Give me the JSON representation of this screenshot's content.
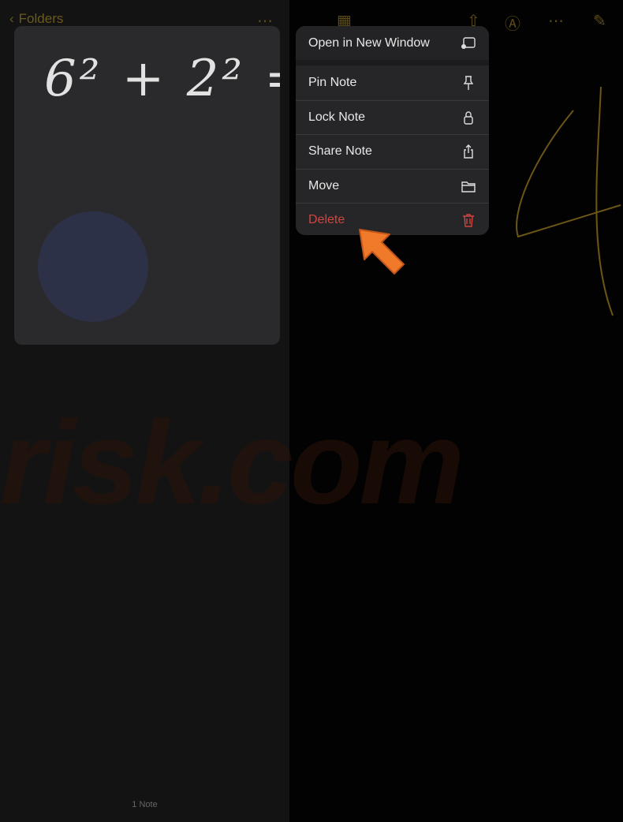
{
  "nav": {
    "back_label": "Folders"
  },
  "note_preview": {
    "handwriting": "6² + 2² = 4"
  },
  "context_menu": {
    "items": [
      {
        "label": "Open in New Window",
        "icon": "new-window-icon"
      },
      {
        "label": "Pin Note",
        "icon": "pin-icon"
      },
      {
        "label": "Lock Note",
        "icon": "lock-icon"
      },
      {
        "label": "Share Note",
        "icon": "share-icon"
      },
      {
        "label": "Move",
        "icon": "folder-icon"
      },
      {
        "label": "Delete",
        "icon": "trash-icon",
        "color": "#d0453f"
      }
    ]
  },
  "watermark": "risk.com",
  "footer": {
    "count": "1 Note"
  },
  "colors": {
    "accent": "#e0a526",
    "destructive": "#d0453f",
    "arrow": "#f07a2a"
  }
}
